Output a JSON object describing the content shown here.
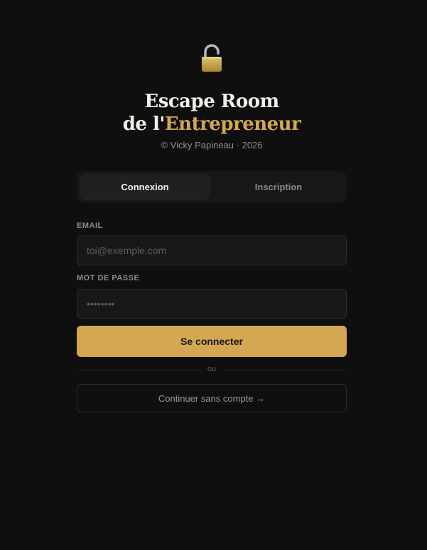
{
  "header": {
    "icon": "open-padlock-icon",
    "title_line1": "Escape Room",
    "title_line2_prefix": "de l'",
    "title_line2_accent": "Entrepreneur",
    "credit": "© Vicky Papineau · 2026"
  },
  "tabs": [
    {
      "label": "Connexion",
      "active": true
    },
    {
      "label": "Inscription",
      "active": false
    }
  ],
  "form": {
    "email_label": "EMAIL",
    "email_placeholder": "toi@exemple.com",
    "email_value": "",
    "password_label": "MOT DE PASSE",
    "password_placeholder": "••••••••",
    "password_value": "",
    "submit_label": "Se connecter",
    "divider_text": "ou",
    "guest_label": "Continuer sans compte →"
  },
  "colors": {
    "background": "#0f0f0f",
    "accent": "#d4a853",
    "field_bg": "#181818",
    "border": "#2e2e2e"
  }
}
